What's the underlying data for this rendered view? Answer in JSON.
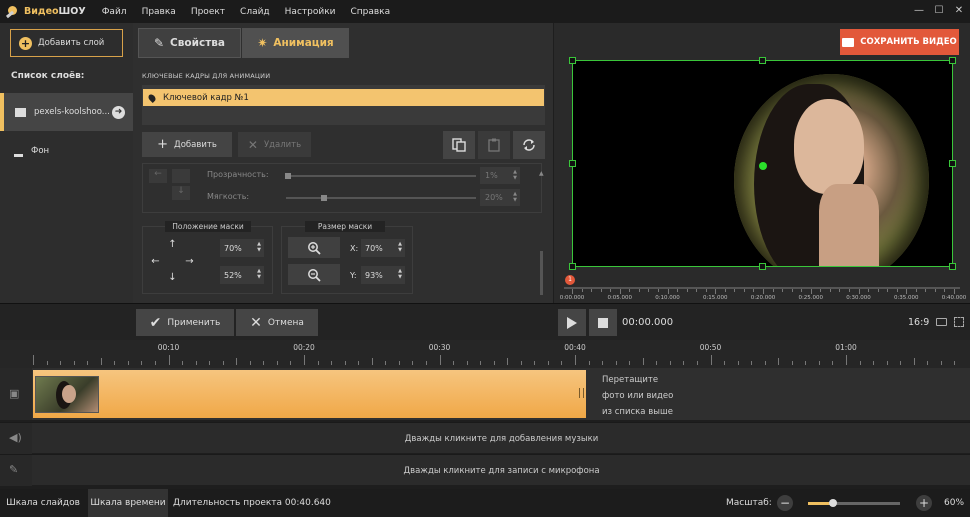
{
  "app": {
    "name_part1": "Видео",
    "name_part2": "ШОУ"
  },
  "menu": [
    "Файл",
    "Правка",
    "Проект",
    "Слайд",
    "Настройки",
    "Справка"
  ],
  "window_controls": {
    "minimize": "—",
    "maximize": "☐",
    "close": "✕"
  },
  "left": {
    "add_layer": "Добавить слой",
    "layers_title": "Список слоёв:",
    "layers": [
      {
        "label": "pexels-koolshoo...",
        "active": true
      },
      {
        "label": "Фон",
        "active": false
      }
    ]
  },
  "tabs": {
    "properties": "Свойства",
    "animation": "Анимация"
  },
  "keyframes": {
    "section_title": "КЛЮЧЕВЫЕ КАДРЫ ДЛЯ АНИМАЦИИ",
    "items": [
      "Ключевой кадр №1"
    ],
    "add_label": "Добавить",
    "delete_label": "Удалить"
  },
  "properties": {
    "opacity_label": "Прозрачность:",
    "opacity_value": "1%",
    "softness_label": "Мягкость:",
    "softness_value": "20%"
  },
  "mask_position": {
    "title": "Положение маски",
    "x_value": "70%",
    "y_value": "52%"
  },
  "mask_size": {
    "title": "Размер маски",
    "x_label": "X:",
    "x_value": "70%",
    "y_label": "Y:",
    "y_value": "93%"
  },
  "preview": {
    "save_label": "СОХРАНИТЬ ВИДЕО",
    "playhead_marker": "1",
    "ruler": [
      "0:00.000",
      "0:05.000",
      "0:10.000",
      "0:15.000",
      "0:20.000",
      "0:25.000",
      "0:30.000",
      "0:35.000",
      "0:40.000"
    ]
  },
  "controls": {
    "apply_label": "Применить",
    "cancel_label": "Отмена",
    "time": "00:00.000",
    "aspect": "16:9"
  },
  "timeline": {
    "labels": [
      "00:10",
      "00:20",
      "00:30",
      "00:40",
      "00:50",
      "01:00"
    ],
    "drop_hint_line1": "Перетащите",
    "drop_hint_line2": "фото или видео",
    "drop_hint_line3": "из списка выше",
    "music_hint": "Дважды кликните для добавления музыки",
    "mic_hint": "Дважды кликните для записи с микрофона"
  },
  "status": {
    "tab_slides": "Шкала слайдов",
    "tab_timeline": "Шкала времени",
    "duration": "Длительность проекта 00:40.640",
    "zoom_label": "Масштаб:",
    "zoom_value": "60%",
    "zoom_fraction": 0.27
  },
  "colors": {
    "accent": "#f0c060",
    "save": "#e2583a",
    "selection": "#3ac63a"
  }
}
